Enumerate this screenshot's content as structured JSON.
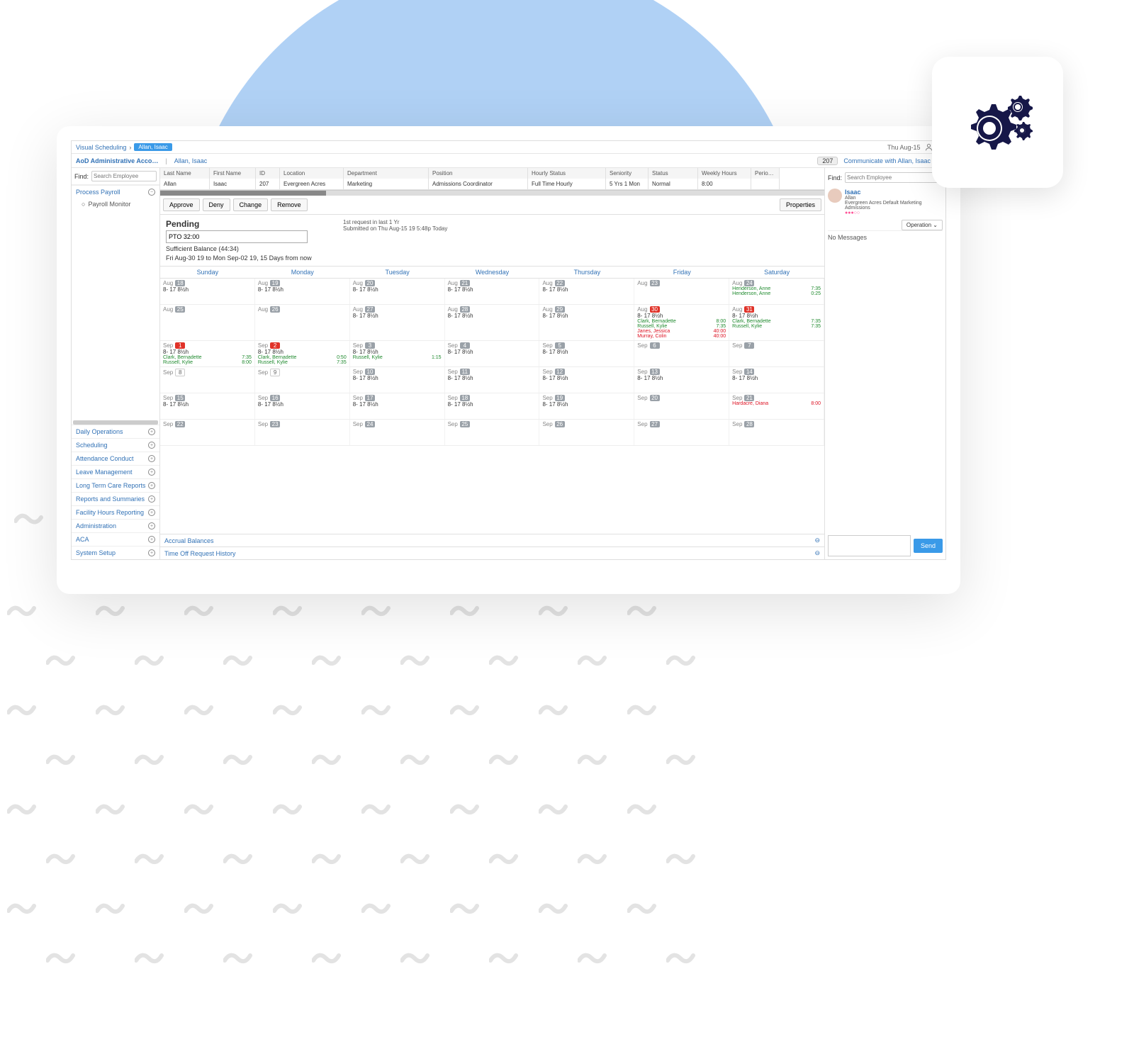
{
  "app": {
    "breadcrumb_root": "Visual Scheduling",
    "breadcrumb_current": "Allan, Isaac",
    "date_display": "Thu Aug-15",
    "account_label": "AoD Administrative Acco…",
    "employee_name": "Allan, Isaac",
    "employee_id_badge": "207",
    "communicate_label": "Communicate with Allan, Isaac"
  },
  "find": {
    "label": "Find:",
    "placeholder": "Search Employee"
  },
  "sidebar": {
    "top": [
      {
        "label": "Process Payroll",
        "icon": "−"
      }
    ],
    "sub": "Payroll Monitor",
    "bottom": [
      {
        "label": "Daily Operations",
        "icon": "+"
      },
      {
        "label": "Scheduling",
        "icon": "+"
      },
      {
        "label": "Attendance Conduct",
        "icon": "+"
      },
      {
        "label": "Leave Management",
        "icon": "+"
      },
      {
        "label": "Long Term Care Reports",
        "icon": "+"
      },
      {
        "label": "Reports and Summaries",
        "icon": "+"
      },
      {
        "label": "Facility Hours Reporting",
        "icon": "+"
      },
      {
        "label": "Administration",
        "icon": "+"
      },
      {
        "label": "ACA",
        "icon": "+"
      },
      {
        "label": "System Setup",
        "icon": "+"
      }
    ]
  },
  "emp_table": {
    "headers": {
      "ln": "Last Name",
      "fn": "First Name",
      "id": "ID",
      "loc": "Location",
      "dep": "Department",
      "pos": "Position",
      "hs": "Hourly Status",
      "sen": "Seniority",
      "st": "Status",
      "wh": "Weekly Hours",
      "pr": "Perio…"
    },
    "row": {
      "ln": "Allan",
      "fn": "Isaac",
      "id": "207",
      "loc": "Evergreen Acres",
      "dep": "Marketing",
      "pos": "Admissions Coordinator",
      "hs": "Full Time Hourly",
      "sen": "5 Yrs 1 Mon",
      "st": "Normal",
      "wh": "8:00",
      "pr": ""
    }
  },
  "toolbar": {
    "approve": "Approve",
    "deny": "Deny",
    "change": "Change",
    "remove": "Remove",
    "properties": "Properties"
  },
  "pending": {
    "title": "Pending",
    "request_count": "1st request in last 1 Yr",
    "pto_value": "PTO 32:00",
    "submitted": "Submitted on Thu Aug-15 19 5:48p Today",
    "balance": "Sufficient Balance (44:34)",
    "range": "Fri Aug-30 19 to Mon Sep-02 19, 15 Days from now"
  },
  "calendar": {
    "days": [
      "Sunday",
      "Monday",
      "Tuesday",
      "Wednesday",
      "Thursday",
      "Friday",
      "Saturday"
    ],
    "default_time": "8- 17   8½h",
    "weeks": [
      {
        "cells": [
          {
            "m": "Aug",
            "d": "18",
            "t": true
          },
          {
            "m": "Aug",
            "d": "19",
            "t": true
          },
          {
            "m": "Aug",
            "d": "20",
            "t": true
          },
          {
            "m": "Aug",
            "d": "21",
            "t": true
          },
          {
            "m": "Aug",
            "d": "22",
            "t": true
          },
          {
            "m": "Aug",
            "d": "23"
          },
          {
            "m": "Aug",
            "d": "24",
            "assign": [
              {
                "n": "Henderson, Anne",
                "v": "7:35"
              },
              {
                "n": "Henderson, Anne",
                "v": "0:25"
              }
            ]
          }
        ]
      },
      {
        "cells": [
          {
            "m": "Aug",
            "d": "25"
          },
          {
            "m": "Aug",
            "d": "26"
          },
          {
            "m": "Aug",
            "d": "27",
            "t": true
          },
          {
            "m": "Aug",
            "d": "28",
            "t": true
          },
          {
            "m": "Aug",
            "d": "29",
            "t": true
          },
          {
            "m": "Aug",
            "d": "30",
            "red": true,
            "t": true,
            "assign": [
              {
                "n": "Clark, Bernadette",
                "v": "8:00"
              },
              {
                "n": "Russell, Kylie",
                "v": "7:35"
              },
              {
                "n": "Janes, Jessica",
                "v": "40:00",
                "red": true
              },
              {
                "n": "Murray, Colin",
                "v": "40:00",
                "red": true
              }
            ]
          },
          {
            "m": "Aug",
            "d": "31",
            "red": true,
            "t": true,
            "assign": [
              {
                "n": "Clark, Bernadette",
                "v": "7:35"
              },
              {
                "n": "Russell, Kylie",
                "v": "7:35"
              }
            ]
          }
        ]
      },
      {
        "cells": [
          {
            "m": "Sep",
            "d": "1",
            "red": true,
            "t": true,
            "assign": [
              {
                "n": "Clark, Bernadette",
                "v": "7:35"
              },
              {
                "n": "Russell, Kylie",
                "v": "8:00"
              }
            ]
          },
          {
            "m": "Sep",
            "d": "2",
            "red": true,
            "t": true,
            "assign": [
              {
                "n": "Clark, Bernadette",
                "v": "0:50"
              },
              {
                "n": "Russell, Kylie",
                "v": "7:35"
              }
            ]
          },
          {
            "m": "Sep",
            "d": "3",
            "t": true,
            "assign": [
              {
                "n": "Russell, Kylie",
                "v": "1:15"
              }
            ]
          },
          {
            "m": "Sep",
            "d": "4",
            "t": true
          },
          {
            "m": "Sep",
            "d": "5",
            "t": true
          },
          {
            "m": "Sep",
            "d": "6"
          },
          {
            "m": "Sep",
            "d": "7"
          }
        ]
      },
      {
        "cells": [
          {
            "m": "Sep",
            "d": "8",
            "white": true
          },
          {
            "m": "Sep",
            "d": "9",
            "white": true
          },
          {
            "m": "Sep",
            "d": "10",
            "t": true
          },
          {
            "m": "Sep",
            "d": "11",
            "t": true
          },
          {
            "m": "Sep",
            "d": "12",
            "t": true
          },
          {
            "m": "Sep",
            "d": "13",
            "t": true
          },
          {
            "m": "Sep",
            "d": "14",
            "t": true
          }
        ]
      },
      {
        "cells": [
          {
            "m": "Sep",
            "d": "15",
            "t": true
          },
          {
            "m": "Sep",
            "d": "16",
            "t": true
          },
          {
            "m": "Sep",
            "d": "17",
            "t": true
          },
          {
            "m": "Sep",
            "d": "18",
            "t": true
          },
          {
            "m": "Sep",
            "d": "19",
            "t": true
          },
          {
            "m": "Sep",
            "d": "20"
          },
          {
            "m": "Sep",
            "d": "21",
            "assign": [
              {
                "n": "Hardacre, Diana",
                "v": "8:00",
                "red": true
              }
            ]
          }
        ]
      },
      {
        "cells": [
          {
            "m": "Sep",
            "d": "22"
          },
          {
            "m": "Sep",
            "d": "23"
          },
          {
            "m": "Sep",
            "d": "24"
          },
          {
            "m": "Sep",
            "d": "25"
          },
          {
            "m": "Sep",
            "d": "26"
          },
          {
            "m": "Sep",
            "d": "27"
          },
          {
            "m": "Sep",
            "d": "28"
          }
        ]
      }
    ]
  },
  "footer_sections": {
    "accrual": "Accrual Balances",
    "history": "Time Off Request History"
  },
  "rightpane": {
    "find_label": "Find:",
    "search_placeholder": "Search Employee",
    "emp_name": "Isaac",
    "emp_last": "Allan",
    "emp_detail": "Evergreen Acres Default Marketing Admissions",
    "operation": "Operation",
    "no_messages": "No Messages",
    "send": "Send"
  }
}
